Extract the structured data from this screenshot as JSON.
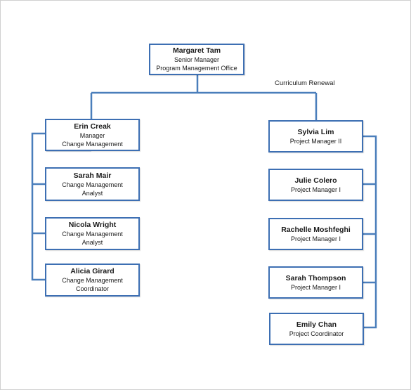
{
  "colors": {
    "line": "#4a7ebb",
    "box_border": "#3d6fb3"
  },
  "top": {
    "name": "Margaret Tam",
    "lines": [
      "Senior Manager",
      "Program Management Office"
    ]
  },
  "branch_label": "Curriculum Renewal",
  "left": [
    {
      "name": "Erin Creak",
      "lines": [
        "Manager",
        "Change Management"
      ]
    },
    {
      "name": "Sarah Mair",
      "lines": [
        "Change Management",
        "Analyst"
      ]
    },
    {
      "name": "Nicola Wright",
      "lines": [
        "Change Management",
        "Analyst"
      ]
    },
    {
      "name": "Alicia Girard",
      "lines": [
        "Change Management",
        "Coordinator"
      ]
    }
  ],
  "right": [
    {
      "name": "Sylvia Lim",
      "lines": [
        "Project Manager II"
      ]
    },
    {
      "name": "Julie Colero",
      "lines": [
        "Project Manager I"
      ]
    },
    {
      "name": "Rachelle Moshfeghi",
      "lines": [
        "Project Manager I"
      ]
    },
    {
      "name": "Sarah Thompson",
      "lines": [
        "Project Manager I"
      ]
    },
    {
      "name": "Emily Chan",
      "lines": [
        "Project Coordinator"
      ]
    }
  ]
}
